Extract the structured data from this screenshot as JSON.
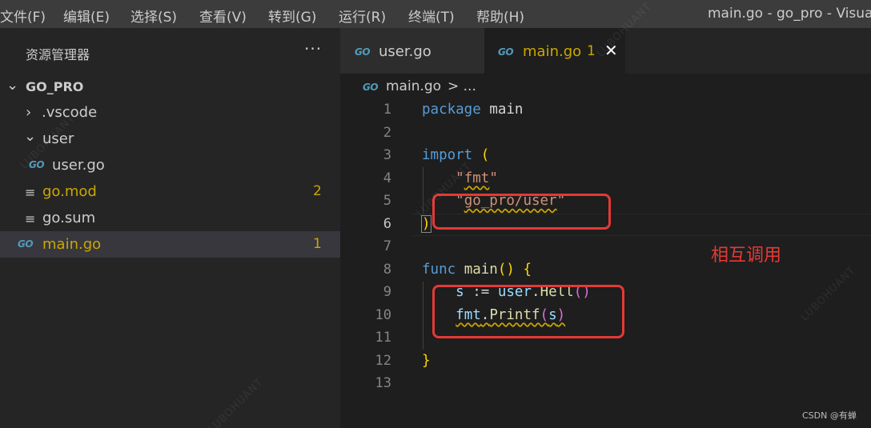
{
  "menubar": {
    "items": [
      "文件(F)",
      "编辑(E)",
      "选择(S)",
      "查看(V)",
      "转到(G)",
      "运行(R)",
      "终端(T)",
      "帮助(H)"
    ],
    "window_title": "main.go - go_pro - Visual"
  },
  "sidebar": {
    "title": "资源管理器",
    "more": "···",
    "root": "GO_PRO",
    "items": [
      {
        "label": ".vscode",
        "type": "folder"
      },
      {
        "label": "user",
        "type": "folder"
      },
      {
        "label": "user.go",
        "type": "go-file"
      },
      {
        "label": "go.mod",
        "type": "mod-file",
        "badge": "2"
      },
      {
        "label": "go.sum",
        "type": "sum-file"
      },
      {
        "label": "main.go",
        "type": "go-file",
        "badge": "1"
      }
    ]
  },
  "tabs": [
    {
      "label": "user.go",
      "active": false
    },
    {
      "label": "main.go",
      "active": true,
      "badge": "1",
      "close": "✕"
    }
  ],
  "breadcrumb": {
    "file": "main.go",
    "rest": "> ..."
  },
  "icons": {
    "go": "GO"
  },
  "editor": {
    "line_numbers": [
      "1",
      "2",
      "3",
      "4",
      "5",
      "6",
      "7",
      "8",
      "9",
      "10",
      "11",
      "12",
      "13"
    ],
    "tokens": {
      "package_kw": "package",
      "package_name": "main",
      "import_kw": "import",
      "open_paren": "(",
      "fmt_quote_open": "\"",
      "fmt_path": "fmt",
      "fmt_quote_close": "\"",
      "user_quote_open": "\"",
      "user_path": "go_pro/user",
      "user_quote_close": "\"",
      "close_paren": ")",
      "func_kw": "func",
      "func_name": "main",
      "func_parens": "()",
      "open_brace": "{",
      "s_var": "s",
      "assign": " := ",
      "user_pkg": "user",
      "dot": ".",
      "hell_fn": "Hell",
      "hell_parens": "()",
      "fmt_pkg": "fmt",
      "printf_fn": "Printf",
      "printf_open": "(",
      "printf_arg": "s",
      "printf_close": ")",
      "close_brace": "}"
    }
  },
  "annotation": "相互调用",
  "watermark": "LUBOHUANT",
  "credit": "CSDN @有蝉",
  "colors": {
    "keyword": "#569cd6",
    "string": "#ce9178",
    "function": "#dcdcaa",
    "variable": "#9cdcfe",
    "warning": "#cca700",
    "annotation": "#e53935"
  }
}
